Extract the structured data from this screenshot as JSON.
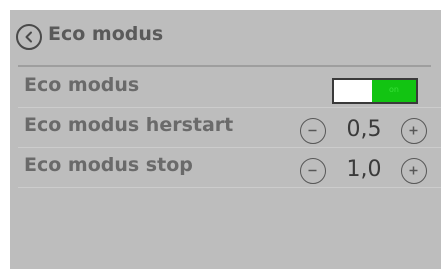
{
  "header": {
    "title": "Eco modus",
    "back_icon": "chevron-left-circle-icon"
  },
  "settings": [
    {
      "label": "Eco modus",
      "control": "toggle",
      "toggle_text": "on",
      "state": "on",
      "on_color": "#12c412"
    },
    {
      "label": "Eco modus herstart",
      "control": "stepper",
      "value": "0,5"
    },
    {
      "label": "Eco modus stop",
      "control": "stepper",
      "value": "1,0"
    }
  ],
  "icons": {
    "decrement": "minus-circle-icon",
    "increment": "plus-circle-icon"
  },
  "colors": {
    "panel_background": "#bdbdbd",
    "text": "#6a6a6a",
    "toggle_on": "#12c412"
  }
}
